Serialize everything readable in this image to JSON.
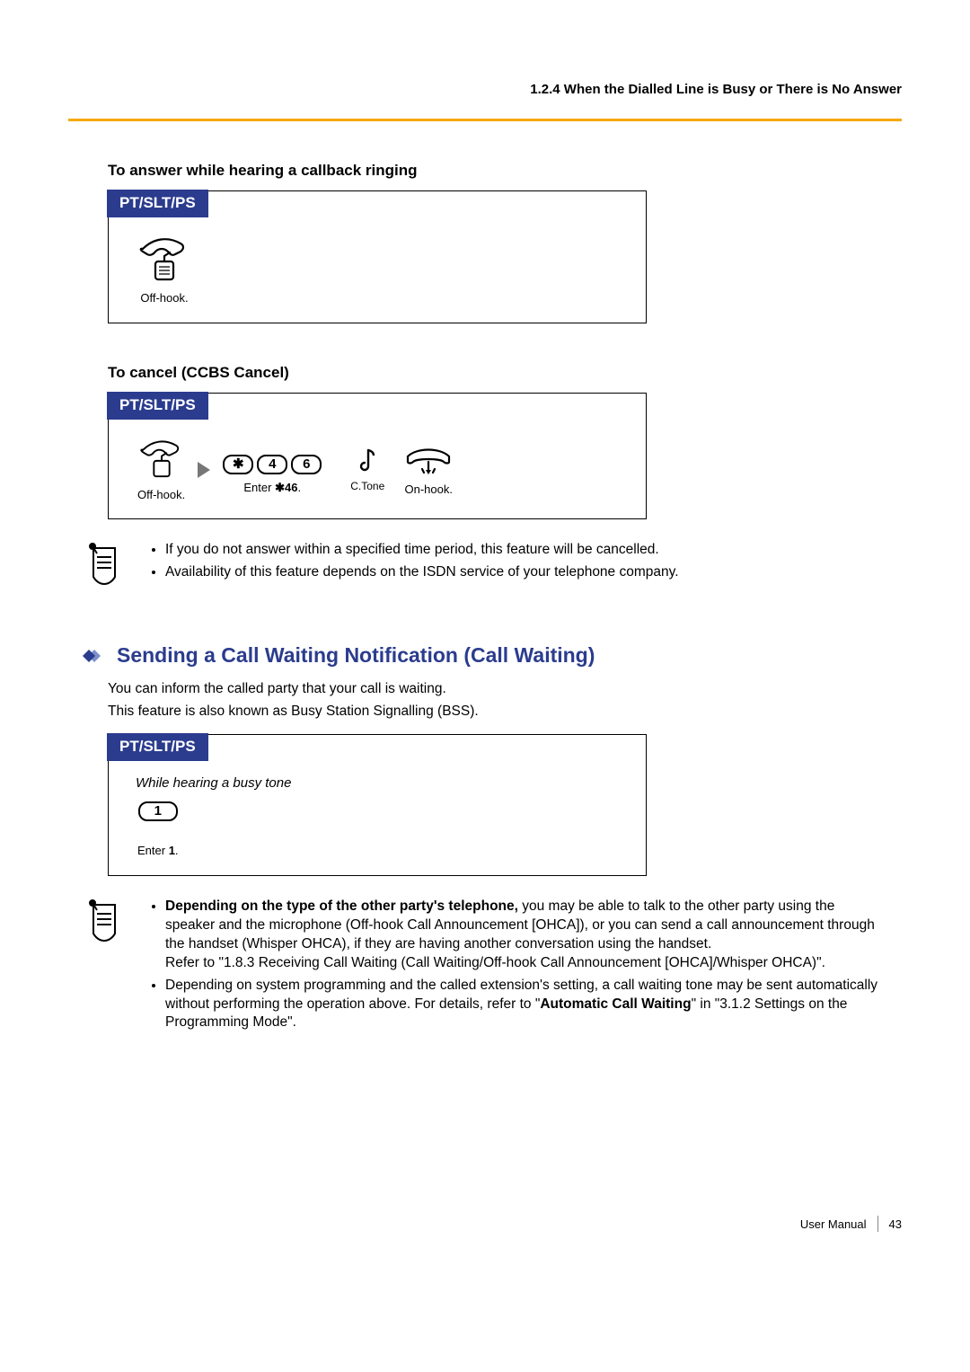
{
  "header": {
    "breadcrumb": "1.2.4 When the Dialled Line is Busy or There is No Answer"
  },
  "sec1": {
    "title": "To answer while hearing a callback ringing",
    "tab": "PT/SLT/PS",
    "step1": "Off-hook."
  },
  "sec2": {
    "title": "To cancel (CCBS Cancel)",
    "tab": "PT/SLT/PS",
    "step1": "Off-hook.",
    "key1": "✱",
    "key2": "4",
    "key3": "6",
    "step2a": "Enter ",
    "step2b": "✱46",
    "step2c": ".",
    "tone": "C.Tone",
    "step3": "On-hook."
  },
  "notes1": {
    "a": "If you do not answer within a specified time period, this feature will be cancelled.",
    "b": "Availability of this feature depends on the ISDN service of your telephone company."
  },
  "h2": "Sending a Call Waiting Notification (Call Waiting)",
  "intro1": "You can inform the called party that your call is waiting.",
  "intro2": "This feature is also known as Busy Station Signalling (BSS).",
  "sec3": {
    "tab": "PT/SLT/PS",
    "cond": "While hearing a busy tone",
    "key": "1",
    "step_a": "Enter ",
    "step_b": "1",
    "step_c": "."
  },
  "notes2": {
    "a_boldlead": "Depending on the type of the other party's telephone,",
    "a_rest": " you may be able to talk to the other party using the speaker and the microphone (Off-hook Call Announcement [OHCA]), or you can send a call announcement through the handset (Whisper OHCA), if they are having another conversation using the handset.",
    "a_ref": "Refer to \"1.8.3  Receiving Call Waiting (Call Waiting/Off-hook Call Announcement [OHCA]/Whisper OHCA)\".",
    "b_pre": "Depending on system programming and the called extension's setting, a call waiting tone may be sent automatically without performing the operation above. For details, refer to \"",
    "b_bold": "Automatic Call Waiting",
    "b_post": "\" in \"3.1.2  Settings on the Programming Mode\"."
  },
  "footer": {
    "label": "User Manual",
    "page": "43"
  }
}
